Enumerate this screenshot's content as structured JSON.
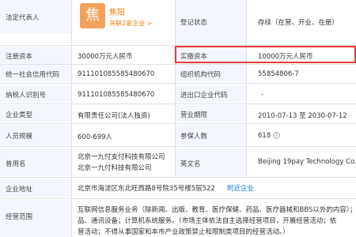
{
  "rows": [
    {
      "l1": "法定代表人",
      "l2": "登记状态",
      "v2": "存续（在营、开业、在册）"
    },
    {
      "l1": "注册资本",
      "v1": "30000万元人民币",
      "l2": "实缴资本",
      "v2": "10000万元人民币"
    },
    {
      "l1": "统一社会信用代码",
      "v1": "911101085585480670",
      "l2": "组织机构代码",
      "v2": "55854806-7"
    },
    {
      "l1": "纳税人识别号",
      "v1": "911101085585480670",
      "l2": "进出口企业代码",
      "v2": "-"
    },
    {
      "l1": "企业类型",
      "v1": "有限责任公司(法人独资)",
      "l2": "营业期限",
      "v2": "2010-07-13 至 2030-07-12"
    },
    {
      "l1": "人员规模",
      "v1": "600-699人",
      "l2": "参保人数",
      "v2": "618"
    },
    {
      "l1": "曾用名",
      "v1a": "北京一九付支付科技有限公司",
      "v1b": "北京一九付科技有限公司",
      "l2": "英文名",
      "v2": "Beijing 19pay Technology Co.,"
    },
    {
      "l1": "企业地址",
      "v1": "北京市海淀区东北旺西路8号院35号楼5层522",
      "link": "附近企业"
    },
    {
      "l1": "经营范围",
      "v1a": "互联网信息服务业务（除新闻、出版、教育、医疗保健、药品、医疗器械和BBS以外的内容）；",
      "v1b": "品、通讯设备；计算机系统服务。（市场主体依法自主选择经营项目，开展经营活动；依",
      "v1c": "营活动；不得从事国家和本市产业政策禁止和限制类项目的经营活动。）"
    }
  ],
  "legal_rep": {
    "avatar": "焦",
    "name": "焦阳",
    "related": "关联2家企业",
    "arrow": ">"
  },
  "colors": {
    "label_bg": "#f3f7fd",
    "border": "#dfe1e3",
    "link": "#0e75d6",
    "avatar": "#f5a25d",
    "highlight": "#e53a3a"
  }
}
